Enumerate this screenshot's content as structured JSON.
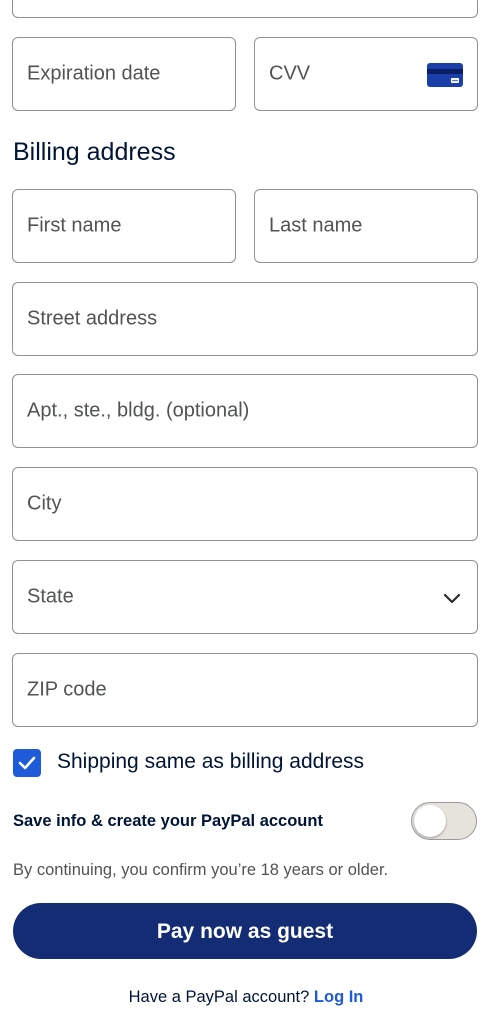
{
  "card": {
    "expiration_placeholder": "Expiration date",
    "cvv_placeholder": "CVV"
  },
  "billing": {
    "title": "Billing address",
    "first_name_placeholder": "First name",
    "last_name_placeholder": "Last name",
    "street_placeholder": "Street address",
    "apt_placeholder": "Apt., ste., bldg. (optional)",
    "city_placeholder": "City",
    "state_placeholder": "State",
    "zip_placeholder": "ZIP code"
  },
  "options": {
    "shipping_same_label": "Shipping same as billing address",
    "shipping_same_checked": true,
    "save_info_label": "Save info & create your PayPal account",
    "save_info_enabled": false
  },
  "age_note": "By continuing, you confirm you’re 18 years or older.",
  "pay_button_label": "Pay now as guest",
  "login": {
    "prompt": "Have a PayPal account?",
    "link_label": "Log In"
  },
  "colors": {
    "primary_button": "#142c73",
    "link": "#1e5bd8",
    "checkbox": "#1e5bd8",
    "heading_text": "#001435"
  }
}
